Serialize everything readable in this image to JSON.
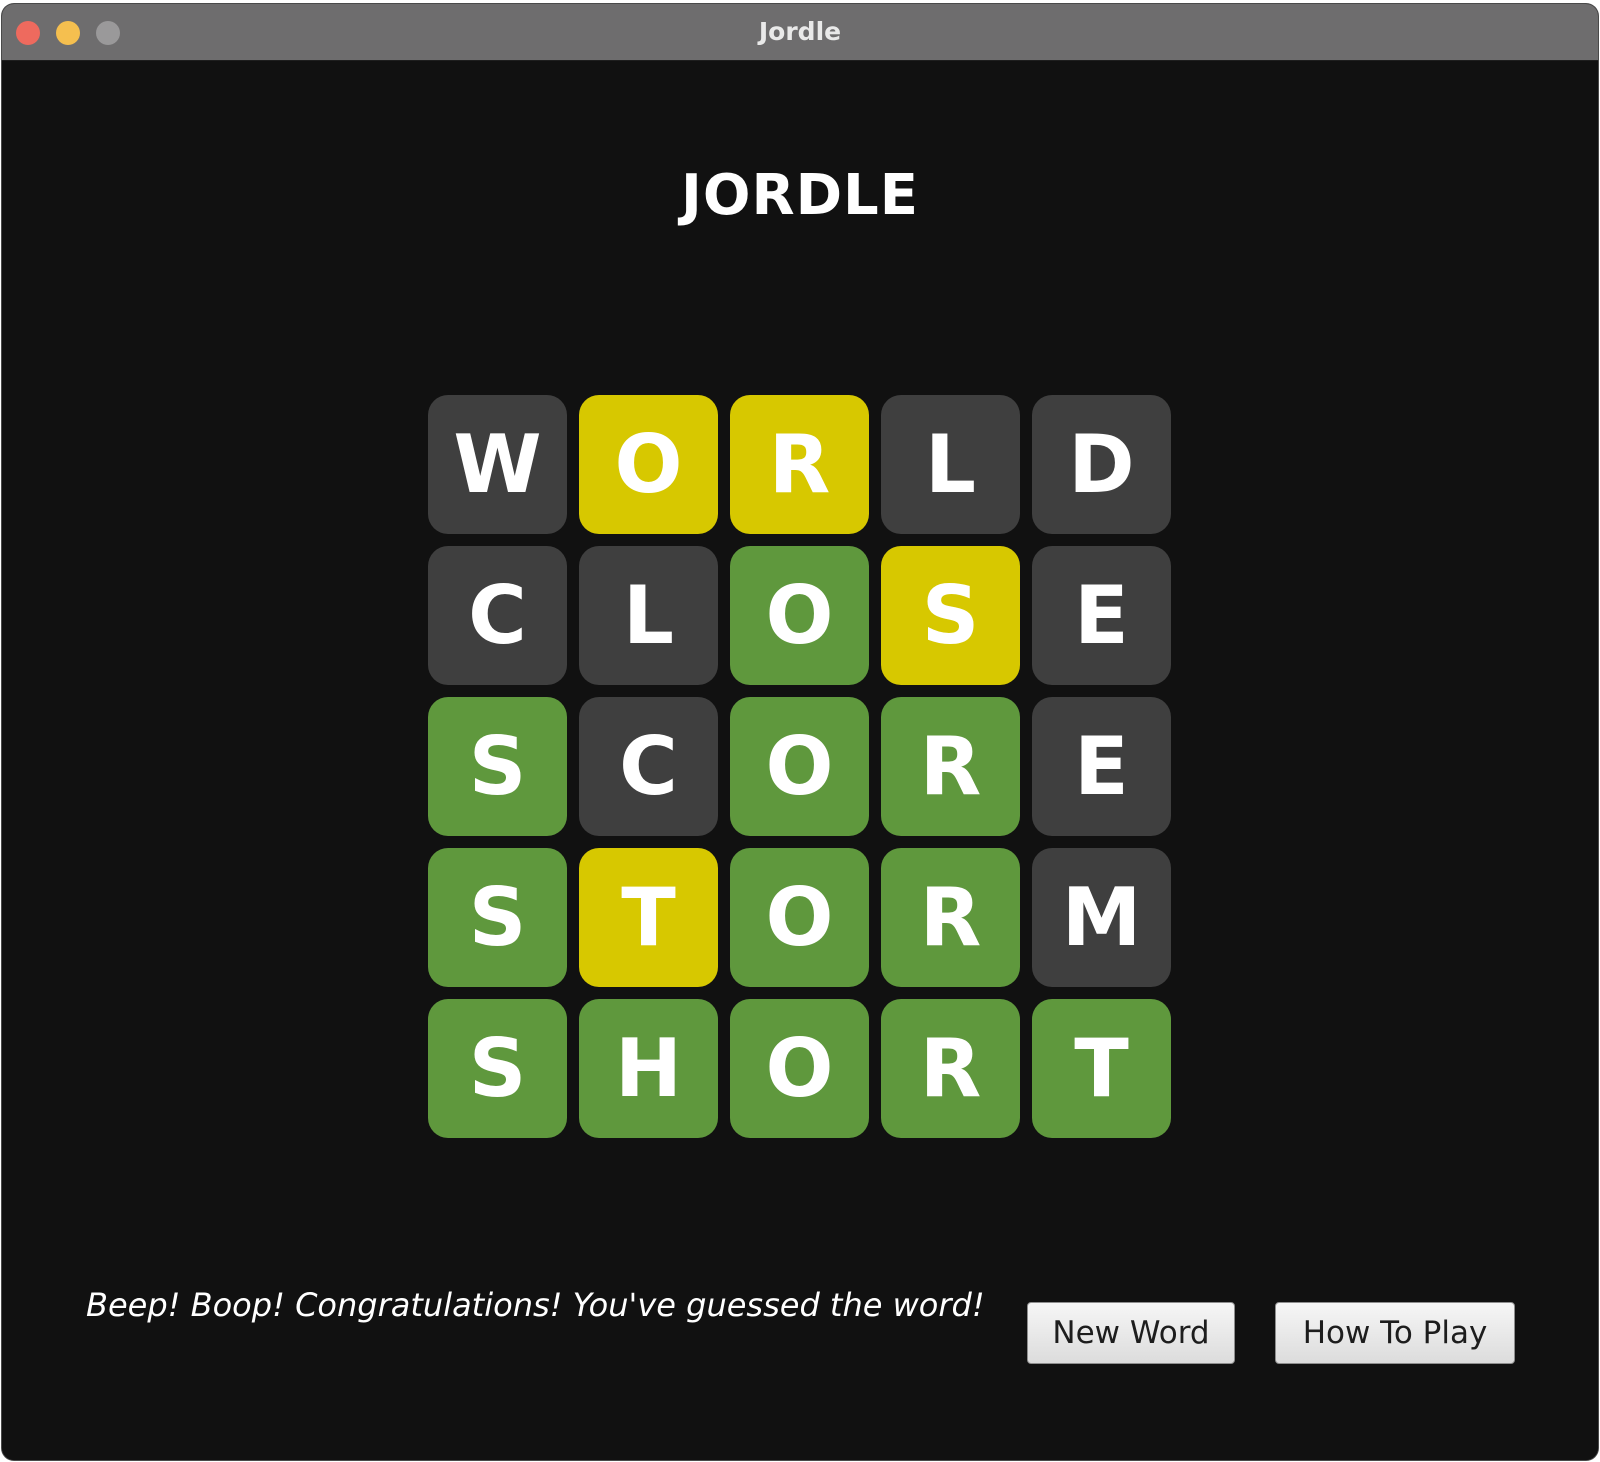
{
  "window": {
    "title": "Jordle"
  },
  "game": {
    "title": "JORDLE",
    "colors": {
      "correct": "#5f983d",
      "present": "#d7c800",
      "absent": "#3f3f3f",
      "background": "#111111"
    },
    "rows": [
      [
        {
          "letter": "W",
          "state": "absent"
        },
        {
          "letter": "O",
          "state": "present"
        },
        {
          "letter": "R",
          "state": "present"
        },
        {
          "letter": "L",
          "state": "absent"
        },
        {
          "letter": "D",
          "state": "absent"
        }
      ],
      [
        {
          "letter": "C",
          "state": "absent"
        },
        {
          "letter": "L",
          "state": "absent"
        },
        {
          "letter": "O",
          "state": "correct"
        },
        {
          "letter": "S",
          "state": "present"
        },
        {
          "letter": "E",
          "state": "absent"
        }
      ],
      [
        {
          "letter": "S",
          "state": "correct"
        },
        {
          "letter": "C",
          "state": "absent"
        },
        {
          "letter": "O",
          "state": "correct"
        },
        {
          "letter": "R",
          "state": "correct"
        },
        {
          "letter": "E",
          "state": "absent"
        }
      ],
      [
        {
          "letter": "S",
          "state": "correct"
        },
        {
          "letter": "T",
          "state": "present"
        },
        {
          "letter": "O",
          "state": "correct"
        },
        {
          "letter": "R",
          "state": "correct"
        },
        {
          "letter": "M",
          "state": "absent"
        }
      ],
      [
        {
          "letter": "S",
          "state": "correct"
        },
        {
          "letter": "H",
          "state": "correct"
        },
        {
          "letter": "O",
          "state": "correct"
        },
        {
          "letter": "R",
          "state": "correct"
        },
        {
          "letter": "T",
          "state": "correct"
        }
      ]
    ]
  },
  "footer": {
    "status_message": "Beep! Boop! Congratulations! You've guessed the word!",
    "new_word_label": "New Word",
    "how_to_play_label": "How To Play"
  }
}
